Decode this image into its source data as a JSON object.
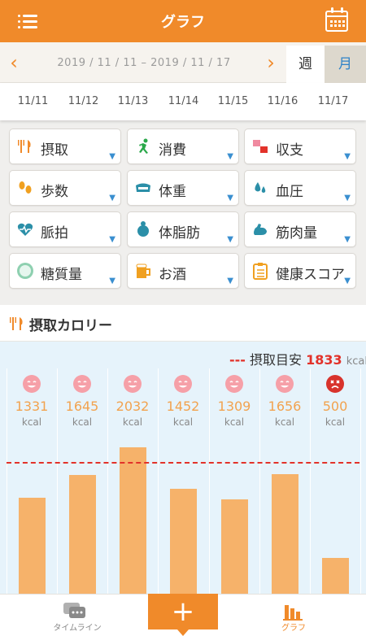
{
  "header": {
    "title": "グラフ",
    "menu_icon": "hamburger-menu-icon",
    "calendar_icon": "calendar-icon"
  },
  "date_range": {
    "text": "2019 / 11 / 11 – 2019 / 11 / 17",
    "prev": "‹",
    "next": "›"
  },
  "period_toggle": {
    "week": "週",
    "month": "月"
  },
  "days": [
    "11/11",
    "11/12",
    "11/13",
    "11/14",
    "11/15",
    "11/16",
    "11/17"
  ],
  "categories": [
    {
      "label": "摂取",
      "icon": "fork-knife-icon"
    },
    {
      "label": "消費",
      "icon": "running-person-icon"
    },
    {
      "label": "収支",
      "icon": "balance-icon"
    },
    {
      "label": "歩数",
      "icon": "footprints-icon"
    },
    {
      "label": "体重",
      "icon": "scale-icon"
    },
    {
      "label": "血圧",
      "icon": "blood-drop-icon"
    },
    {
      "label": "脈拍",
      "icon": "heart-pulse-icon"
    },
    {
      "label": "体脂肪",
      "icon": "body-fat-icon"
    },
    {
      "label": "筋肉量",
      "icon": "muscle-icon"
    },
    {
      "label": "糖質量",
      "icon": "sugar-icon"
    },
    {
      "label": "お酒",
      "icon": "beer-icon"
    },
    {
      "label": "健康スコア",
      "icon": "clipboard-icon"
    }
  ],
  "section": {
    "title": "摂取カロリー",
    "icon": "fork-knife-icon"
  },
  "target": {
    "dash": "---",
    "label": "摂取目安",
    "value": "1833",
    "unit": "kcal"
  },
  "chart_data": {
    "type": "bar",
    "categories": [
      "11/11",
      "11/12",
      "11/13",
      "11/14",
      "11/15",
      "11/16",
      "11/17"
    ],
    "values": [
      1331,
      1645,
      2032,
      1452,
      1309,
      1656,
      500
    ],
    "value_labels": [
      "1331",
      "1645",
      "2032",
      "1452",
      "1309",
      "1656",
      "500"
    ],
    "unit": "kcal",
    "status": [
      "good",
      "good",
      "good",
      "good",
      "good",
      "good",
      "bad"
    ],
    "target": 1833,
    "bar_color": "#f6b26a",
    "target_color": "#e2322a"
  },
  "tabbar": {
    "timeline": "タイムライン",
    "add": "+",
    "graph": "グラフ"
  },
  "colors": {
    "accent": "#f08a2a",
    "link_blue": "#2f83c8",
    "chart_bg": "#e6f3fb"
  }
}
